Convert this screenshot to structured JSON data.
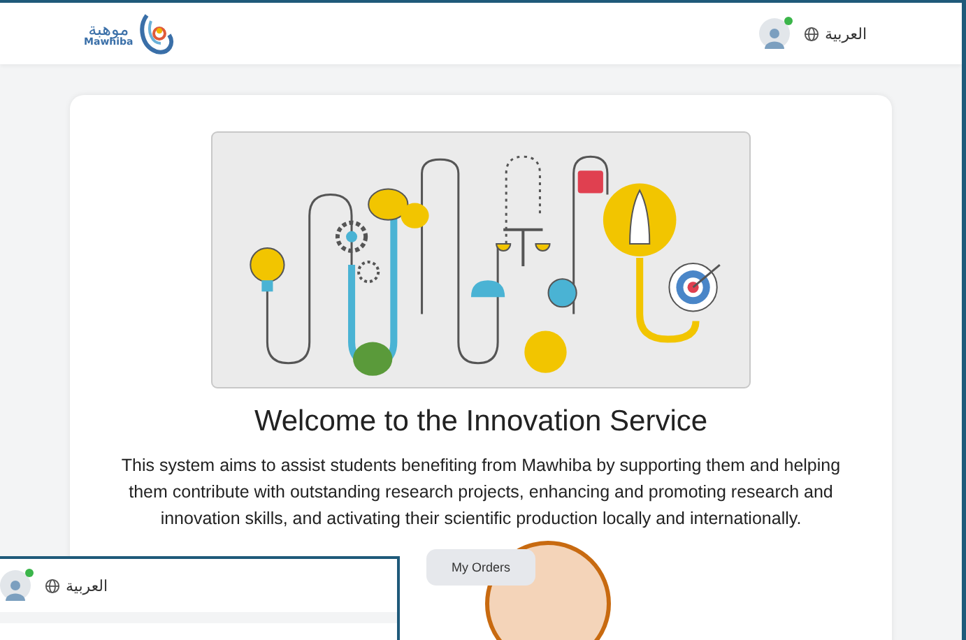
{
  "header": {
    "logo_arabic": "موهبة",
    "logo_latin": "Mawhiba",
    "language_link": "العربية",
    "user": {
      "online": true
    }
  },
  "welcome": {
    "title": "Welcome to the Innovation Service",
    "description": "This system aims to assist students benefiting from Mawhiba by supporting them and helping them contribute with outstanding research projects, enhancing and promoting research and innovation skills, and activating their scientific production locally and internationally.",
    "button": "My Orders"
  },
  "inset": {
    "language_link": "العربية",
    "user": {
      "online": true
    }
  }
}
